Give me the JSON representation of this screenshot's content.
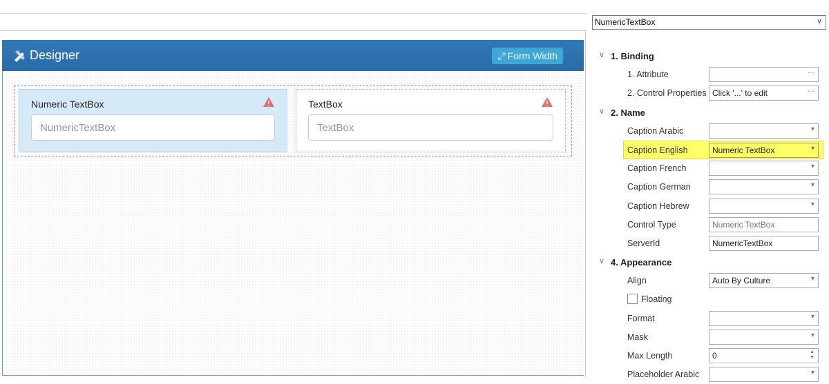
{
  "designer": {
    "title": "Designer",
    "form_width_label": "Form Width"
  },
  "controls": [
    {
      "caption": "Numeric TextBox",
      "placeholder": "NumericTextBox",
      "selected": true
    },
    {
      "caption": "TextBox",
      "placeholder": "TextBox",
      "selected": false
    }
  ],
  "properties": {
    "selected_control": "NumericTextBox",
    "rows": [
      {
        "type": "header",
        "label": "1. Binding"
      },
      {
        "type": "ellipsis",
        "label": "1. Attribute",
        "value": ""
      },
      {
        "type": "ellipsis",
        "label": "2. Control Properties",
        "value": "Click '...' to edit"
      },
      {
        "type": "header",
        "label": "2. Name"
      },
      {
        "type": "select",
        "label": "Caption Arabic",
        "value": ""
      },
      {
        "type": "select",
        "label": "Caption English",
        "value": "Numeric TextBox",
        "highlight": true
      },
      {
        "type": "select",
        "label": "Caption French",
        "value": ""
      },
      {
        "type": "select",
        "label": "Caption German",
        "value": ""
      },
      {
        "type": "select",
        "label": "Caption Hebrew",
        "value": ""
      },
      {
        "type": "readonly",
        "label": "Control Type",
        "value": "Numeric TextBox"
      },
      {
        "type": "text",
        "label": "ServerId",
        "value": "NumericTextBox"
      },
      {
        "type": "header",
        "label": "4. Appearance"
      },
      {
        "type": "select",
        "label": "Align",
        "value": "Auto By Culture"
      },
      {
        "type": "checkbox",
        "label": "Floating",
        "checked": false
      },
      {
        "type": "select",
        "label": "Format",
        "value": ""
      },
      {
        "type": "select",
        "label": "Mask",
        "value": ""
      },
      {
        "type": "spin",
        "label": "Max Length",
        "value": "0"
      },
      {
        "type": "select",
        "label": "Placeholder Arabic",
        "value": ""
      }
    ]
  }
}
